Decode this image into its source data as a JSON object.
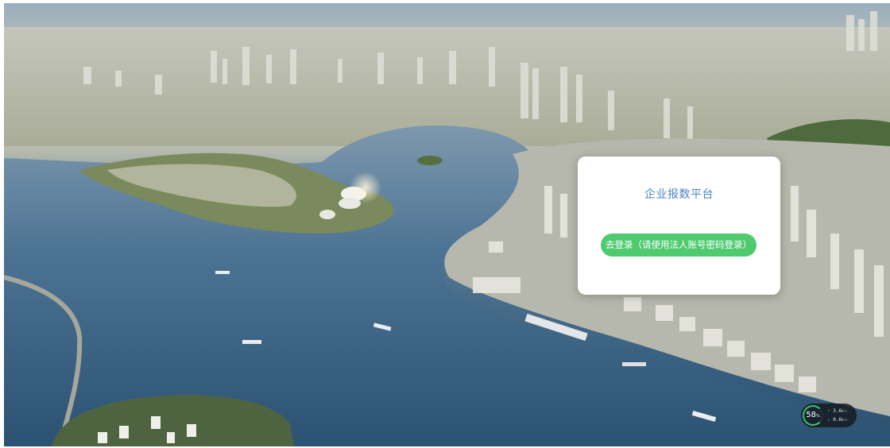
{
  "card": {
    "title": "企业报数平台",
    "login_label": "去登录（请使用法人账号密码登录）"
  },
  "net_widget": {
    "percent": "58",
    "percent_unit": "%",
    "upload": "3.6",
    "upload_unit": "K/s",
    "download": "0.6",
    "download_unit": "K/s"
  },
  "colors": {
    "title": "#4a86c8",
    "button": "#4fca6f",
    "widget_ring": "#39c46b"
  }
}
